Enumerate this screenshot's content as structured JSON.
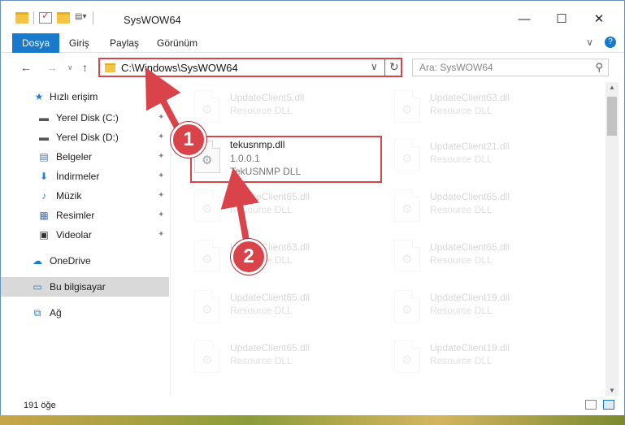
{
  "window": {
    "title": "SysWOW64",
    "buttons": {
      "minimize": "—",
      "maximize": "☐",
      "close": "✕"
    }
  },
  "ribbon": {
    "tabs": [
      "Dosya",
      "Giriş",
      "Paylaş",
      "Görünüm"
    ],
    "active_tab": "Dosya",
    "expand_icon": "∨",
    "help_icon": "?"
  },
  "nav": {
    "back": "←",
    "forward": "→",
    "recent": "∨",
    "up": "↑",
    "address": "C:\\Windows\\SysWOW64",
    "address_chevron": "∨",
    "refresh": "↻",
    "search_placeholder": "Ara: SysWOW64",
    "search_icon": "⚲"
  },
  "sidebar": {
    "items": [
      {
        "label": "Hızlı erişim",
        "icon": "star-icon",
        "glyph": "★",
        "pinned": false
      },
      {
        "label": "Yerel Disk (C:)",
        "icon": "drive-icon",
        "glyph": "▬",
        "pinned": true
      },
      {
        "label": "Yerel Disk (D:)",
        "icon": "drive-icon",
        "glyph": "▬",
        "pinned": true
      },
      {
        "label": "Belgeler",
        "icon": "document-icon",
        "glyph": "▤",
        "pinned": true
      },
      {
        "label": "İndirmeler",
        "icon": "download-icon",
        "glyph": "⬇",
        "pinned": true
      },
      {
        "label": "Müzik",
        "icon": "music-icon",
        "glyph": "♪",
        "pinned": true
      },
      {
        "label": "Resimler",
        "icon": "pictures-icon",
        "glyph": "▦",
        "pinned": true
      },
      {
        "label": "Videolar",
        "icon": "video-icon",
        "glyph": "▣",
        "pinned": true
      },
      {
        "label": "OneDrive",
        "icon": "cloud-icon",
        "glyph": "☁",
        "pinned": false
      },
      {
        "label": "Bu bilgisayar",
        "icon": "computer-icon",
        "glyph": "▭",
        "pinned": false
      },
      {
        "label": "Ağ",
        "icon": "network-icon",
        "glyph": "⧉",
        "pinned": false
      }
    ],
    "selected": "Bu bilgisayar",
    "pin_glyph": "📌"
  },
  "files": {
    "highlighted": {
      "name": "tekusnmp.dll",
      "version": "1.0.0.1",
      "description": "TekUSNMP DLL"
    },
    "left_column": [
      {
        "name": "UpdateClient5.dll",
        "type": "Resource DLL"
      },
      {
        "name": "UpdateClient65.dll",
        "type": "Resource DLL"
      },
      {
        "name": "UpdateClient63.dll",
        "type": "Resource DLL"
      },
      {
        "name": "UpdateClient65.dll",
        "type": "Resource DLL"
      },
      {
        "name": "UpdateClient65.dll",
        "type": "Resource DLL"
      }
    ],
    "right_column": [
      {
        "name": "UpdateClient63.dll",
        "type": "Resource DLL"
      },
      {
        "name": "UpdateClient21.dll",
        "type": "Resource DLL"
      },
      {
        "name": "UpdateClient65.dll",
        "type": "Resource DLL"
      },
      {
        "name": "UpdateClient65.dll",
        "type": "Resource DLL"
      },
      {
        "name": "UpdateClient19.dll",
        "type": "Resource DLL"
      },
      {
        "name": "UpdateClient19.dll",
        "type": "Resource DLL"
      }
    ]
  },
  "status": {
    "count_text": "191 öğe"
  },
  "annotations": {
    "step1": "1",
    "step2": "2",
    "accent_color": "#d9434a"
  }
}
